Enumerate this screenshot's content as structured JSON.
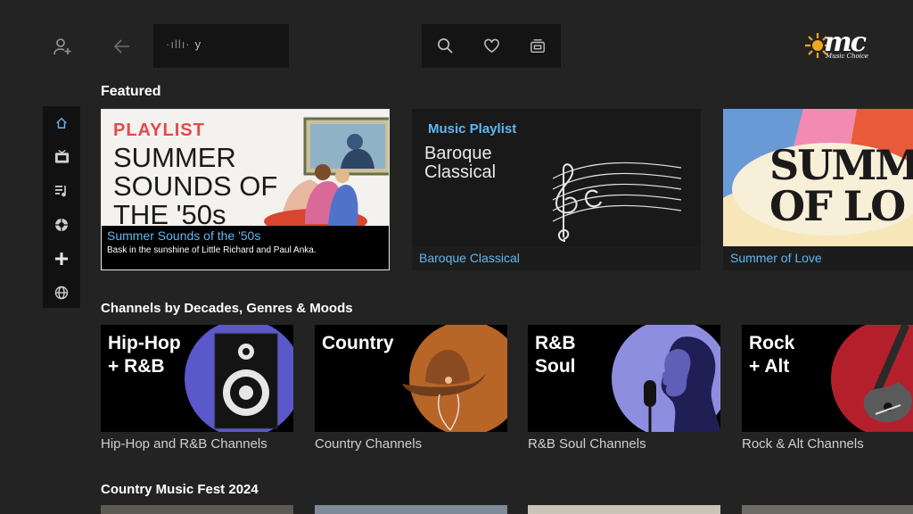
{
  "header": {
    "search": {
      "wave": "·ıllı·",
      "query": "y"
    },
    "logo": {
      "letters": "mc",
      "sub": "Music Choice"
    }
  },
  "icons": {
    "profile": "add-user-icon",
    "back": "back-arrow-icon",
    "search": "search-icon",
    "favorites": "heart-icon",
    "tv": "tv-icon"
  },
  "sidebar": {
    "items": [
      {
        "icon": "home-icon",
        "active": true
      },
      {
        "icon": "tv-icon"
      },
      {
        "icon": "playlist-icon"
      },
      {
        "icon": "aperture-icon"
      },
      {
        "icon": "plus-icon"
      },
      {
        "icon": "globe-icon"
      }
    ]
  },
  "featured": {
    "title": "Featured",
    "cards": [
      {
        "badge": "PLAYLIST",
        "headline": "SUMMER\nSOUNDS OF\nTHE '50s",
        "caption": "Summer Sounds of the '50s",
        "description": "Bask in the sunshine of Little Richard and Paul Anka."
      },
      {
        "badge": "Music Playlist",
        "headline": "Baroque\nClassical",
        "caption": "Baroque Classical"
      },
      {
        "headline": "SUMMER\nOF LO",
        "caption": "Summer of Love"
      }
    ]
  },
  "genres": {
    "title": "Channels by Decades, Genres & Moods",
    "cards": [
      {
        "label": "Hip-Hop\n+ R&B",
        "caption": "Hip-Hop and R&B Channels"
      },
      {
        "label": "Country",
        "caption": "Country Channels"
      },
      {
        "label": "R&B\nSoul",
        "caption": "R&B Soul Channels"
      },
      {
        "label": "Rock\n+ Alt",
        "caption": "Rock & Alt Channels"
      }
    ]
  },
  "country_fest": {
    "title": "Country Music Fest 2024"
  },
  "colors": {
    "background": "#232323",
    "accent_blue": "#5fb7f2",
    "hiphop": "#5b58c9",
    "country": "#b86528",
    "rnb": "#8e8ee0",
    "rock": "#b3202c"
  }
}
